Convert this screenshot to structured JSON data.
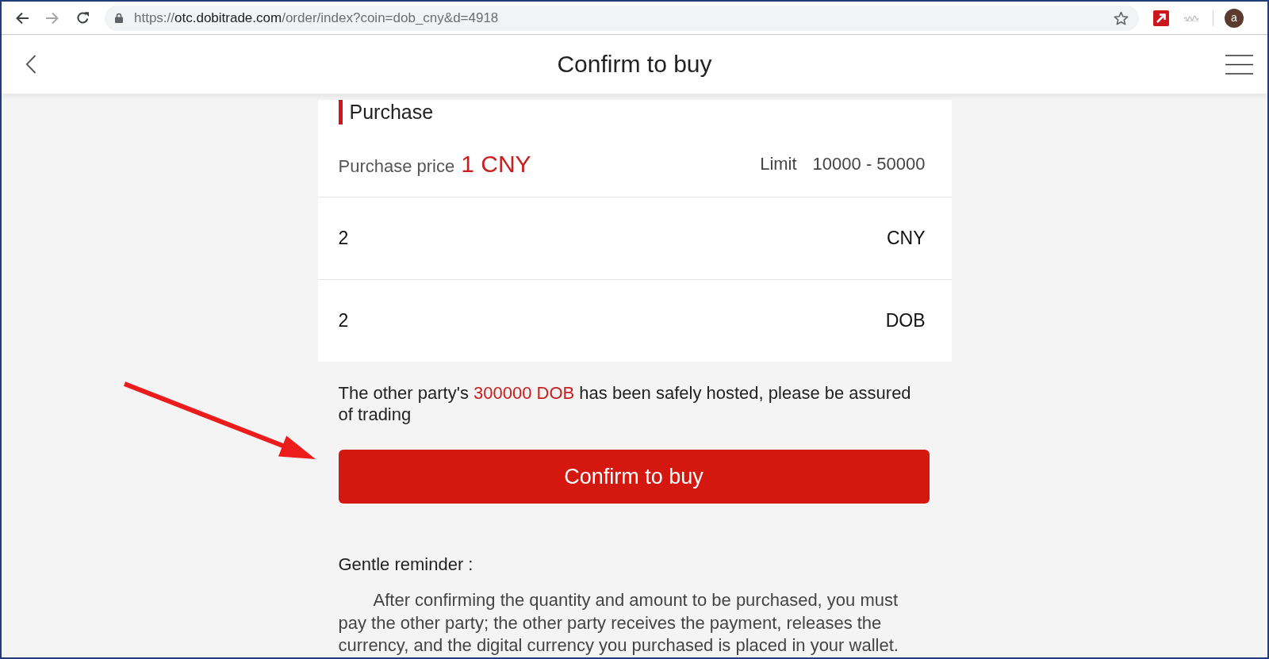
{
  "browser": {
    "forward_disabled": true,
    "url": [
      {
        "text": "https://",
        "kind": "scheme"
      },
      {
        "text": "otc.dobitrade.com",
        "kind": "host"
      },
      {
        "text": "/order/index?coin=dob_cny&d=4918",
        "kind": "path"
      }
    ],
    "profile_initial": "a"
  },
  "header": {
    "title": "Confirm to buy"
  },
  "purchase": {
    "section_title": "Purchase",
    "price_label": "Purchase price",
    "price": "1 CNY",
    "limit_label": "Limit",
    "limit": "10000 - 50000",
    "fields": [
      {
        "value": "2",
        "unit": "CNY"
      },
      {
        "value": "2",
        "unit": "DOB"
      }
    ]
  },
  "notice": [
    {
      "text": "The other party's ",
      "highlight": false
    },
    {
      "text": "300000 DOB",
      "highlight": true
    },
    {
      "text": " has been safely hosted, please be assured of trading",
      "highlight": false
    }
  ],
  "confirm_button": "Confirm to buy",
  "reminder": {
    "title": "Gentle reminder :",
    "text": "After confirming the quantity and amount to be purchased, you must pay the other party; the other party receives the payment, releases the currency, and the digital currency you purchased is placed in your wallet."
  }
}
